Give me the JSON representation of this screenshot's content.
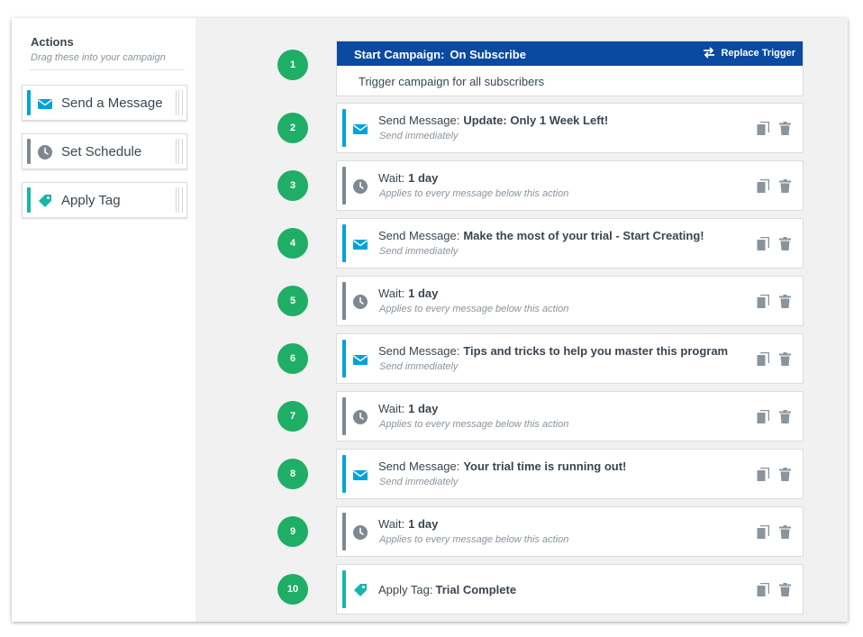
{
  "sidebar": {
    "title": "Actions",
    "subtitle": "Drag these  into your campaign",
    "items": [
      {
        "label": "Send a Message",
        "icon": "envelope-icon",
        "color": "#00a3d9"
      },
      {
        "label": "Set Schedule",
        "icon": "clock-icon",
        "color": "#7f8891"
      },
      {
        "label": "Apply Tag",
        "icon": "tag-icon",
        "color": "#17b5a9"
      }
    ]
  },
  "trigger": {
    "label": "Start Campaign:",
    "value": "On Subscribe",
    "replace_label": "Replace Trigger",
    "description": "Trigger campaign for all subscribers",
    "header_color": "#0a4aa0"
  },
  "steps": [
    {
      "number": "1"
    },
    {
      "number": "2",
      "type": "Send Message:",
      "value": "Update: Only 1 Week Left!",
      "sub": "Send immediately"
    },
    {
      "number": "3",
      "type": "Wait:",
      "value": "1 day",
      "sub": "Applies to every message below this action"
    },
    {
      "number": "4",
      "type": "Send Message:",
      "value": "Make the most of your trial - Start Creating!",
      "sub": "Send immediately"
    },
    {
      "number": "5",
      "type": "Wait:",
      "value": "1 day",
      "sub": "Applies to every message below this action"
    },
    {
      "number": "6",
      "type": "Send Message:",
      "value": "Tips and tricks to help you master this program",
      "sub": "Send immediately"
    },
    {
      "number": "7",
      "type": "Wait:",
      "value": "1 day",
      "sub": "Applies to every message below this action"
    },
    {
      "number": "8",
      "type": "Send Message:",
      "value": "Your trial time is running out!",
      "sub": "Send immediately"
    },
    {
      "number": "9",
      "type": "Wait:",
      "value": "1 day",
      "sub": "Applies to every message below this action"
    },
    {
      "number": "10",
      "type": "Apply Tag:",
      "value": "Trial Complete"
    }
  ],
  "colors": {
    "step_badge": "#1fae66",
    "message": "#00a3d9",
    "wait": "#7f8891",
    "tag": "#17b5a9"
  }
}
